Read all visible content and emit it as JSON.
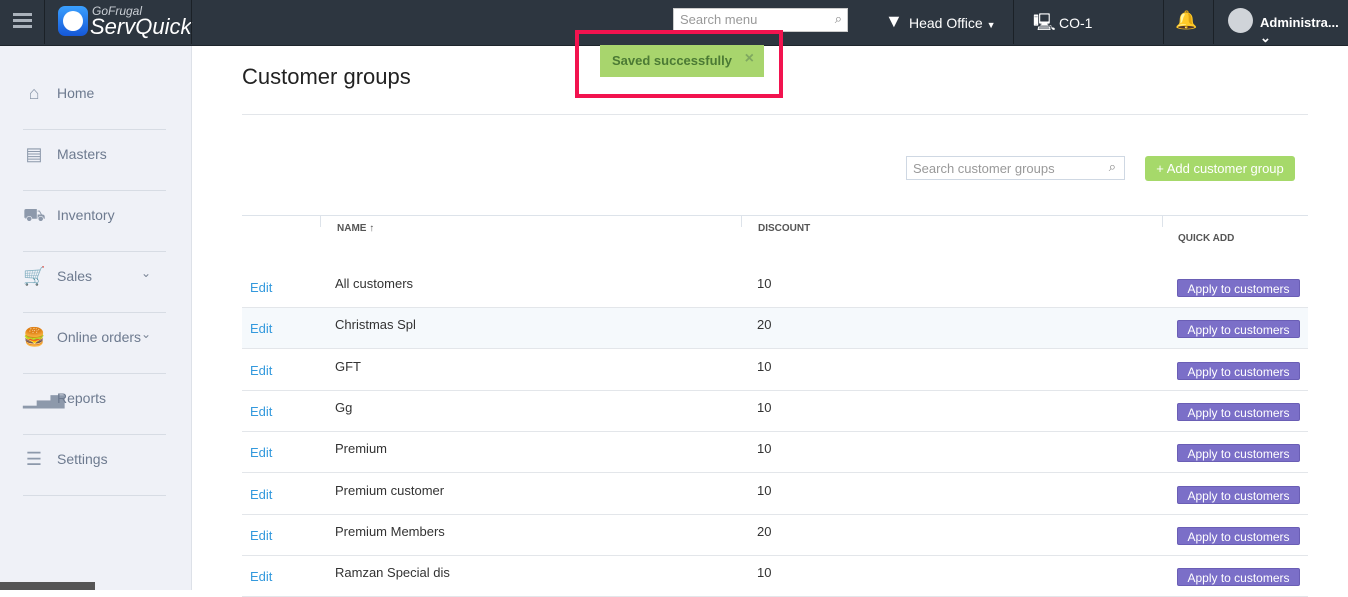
{
  "header": {
    "brand_top": "GoFrugal",
    "brand": "ServQuick",
    "search_placeholder": "Search menu",
    "location": "Head Office",
    "counter": "CO-1",
    "user": "Administra..."
  },
  "sidebar": {
    "items": [
      {
        "label": "Home",
        "icon": "home-icon"
      },
      {
        "label": "Masters",
        "icon": "masters-icon"
      },
      {
        "label": "Inventory",
        "icon": "inventory-icon"
      },
      {
        "label": "Sales",
        "icon": "cart-icon",
        "chevron": true
      },
      {
        "label": "Online orders",
        "icon": "food-icon",
        "chevron": true
      },
      {
        "label": "Reports",
        "icon": "reports-icon"
      },
      {
        "label": "Settings",
        "icon": "settings-icon"
      }
    ]
  },
  "toast": {
    "message": "Saved successfully",
    "close": "×"
  },
  "main": {
    "title": "Customer groups",
    "search_placeholder": "Search customer groups",
    "add_label": "+ Add customer group",
    "columns": {
      "name": "NAME ↑",
      "discount": "DISCOUNT",
      "quick_add": "QUICK ADD"
    },
    "rows": [
      {
        "edit": "Edit",
        "name": "All customers",
        "discount": "10",
        "action": "Apply to customers"
      },
      {
        "edit": "Edit",
        "name": "Christmas Spl",
        "discount": "20",
        "action": "Apply to customers"
      },
      {
        "edit": "Edit",
        "name": "GFT",
        "discount": "10",
        "action": "Apply to customers"
      },
      {
        "edit": "Edit",
        "name": "Gg",
        "discount": "10",
        "action": "Apply to customers"
      },
      {
        "edit": "Edit",
        "name": "Premium",
        "discount": "10",
        "action": "Apply to customers"
      },
      {
        "edit": "Edit",
        "name": "Premium customer",
        "discount": "10",
        "action": "Apply to customers"
      },
      {
        "edit": "Edit",
        "name": "Premium Members",
        "discount": "20",
        "action": "Apply to customers"
      },
      {
        "edit": "Edit",
        "name": "Ramzan Special dis",
        "discount": "10",
        "action": "Apply to customers"
      }
    ]
  },
  "colors": {
    "header": "#2d3640",
    "accent_green": "#a6d96a",
    "apply_purple": "#7b6fc8",
    "highlight": "#f2134f"
  }
}
